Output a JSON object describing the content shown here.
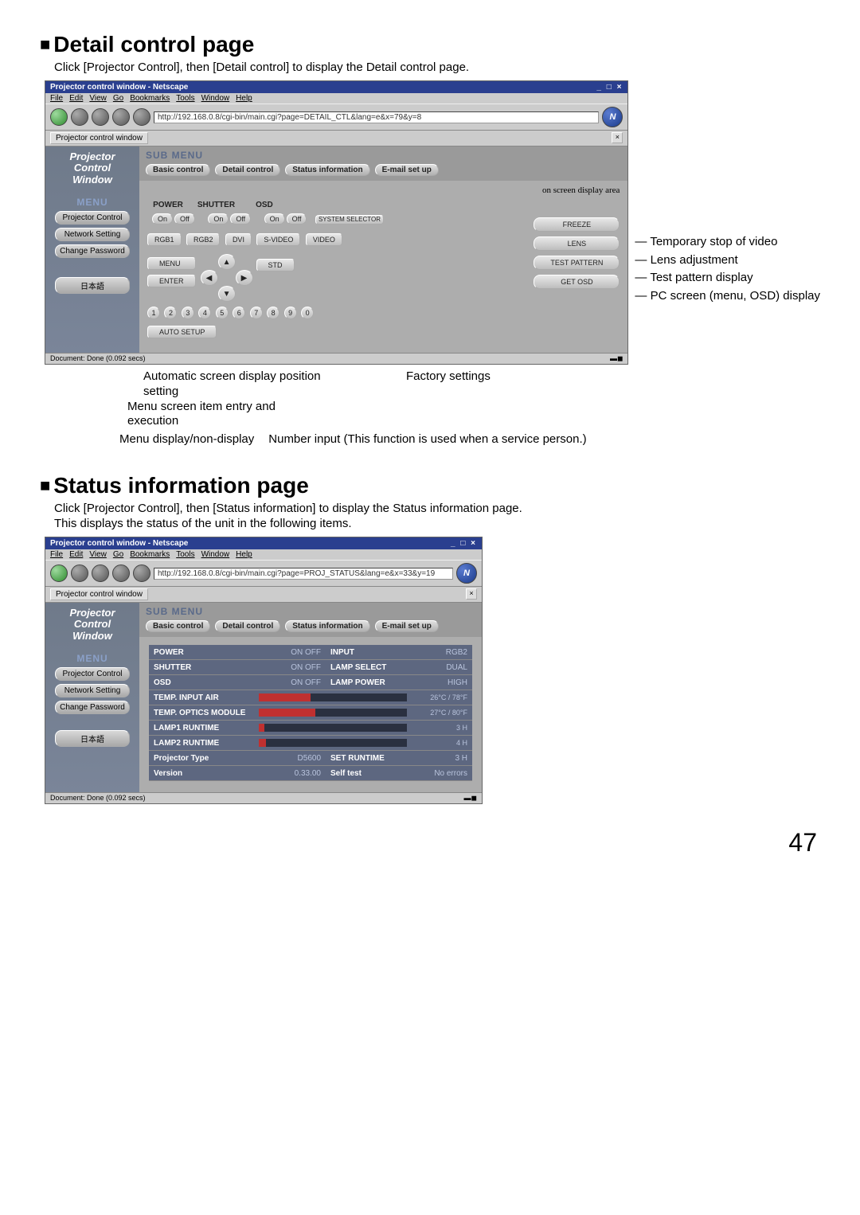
{
  "page_number": "47",
  "section1": {
    "title": "Detail control page",
    "intro": "Click [Projector Control], then [Detail control] to display the Detail control page."
  },
  "section2": {
    "title": "Status information page",
    "intro1": "Click [Projector Control], then [Status information] to display the Status information page.",
    "intro2": "This displays the status of the unit in the following items."
  },
  "browser": {
    "title": "Projector control window - Netscape",
    "winbtns": "_ □ ×",
    "menu": [
      "File",
      "Edit",
      "View",
      "Go",
      "Bookmarks",
      "Tools",
      "Window",
      "Help"
    ],
    "url1": "http://192.168.0.8/cgi-bin/main.cgi?page=DETAIL_CTL&lang=e&x=79&y=8",
    "url2": "http://192.168.0.8/cgi-bin/main.cgi?page=PROJ_STATUS&lang=e&x=33&y=19",
    "tab": "Projector control window",
    "status": "Document: Done (0.092 secs)"
  },
  "sidebar": {
    "title_l1": "Projector",
    "title_l2": "Control",
    "title_l3": "Window",
    "menu_lbl": "MENU",
    "buttons": [
      "Projector Control",
      "Network Setting",
      "Change Password",
      "日本語"
    ]
  },
  "subtabs": {
    "header": "SUB MENU",
    "items": [
      "Basic control",
      "Detail control",
      "Status information",
      "E-mail set up"
    ]
  },
  "detail": {
    "osda": "on screen display area",
    "labels": {
      "power": "POWER",
      "shutter": "SHUTTER",
      "osd": "OSD"
    },
    "on": "On",
    "off": "Off",
    "system_selector": "SYSTEM SELECTOR",
    "inputs": [
      "RGB1",
      "RGB2",
      "DVI",
      "S-VIDEO",
      "VIDEO"
    ],
    "menu": "MENU",
    "std": "STD",
    "enter": "ENTER",
    "nums": [
      "1",
      "2",
      "3",
      "4",
      "5",
      "6",
      "7",
      "8",
      "9",
      "0"
    ],
    "auto_setup": "AUTO SETUP",
    "right_btns": [
      "FREEZE",
      "LENS",
      "TEST PATTERN",
      "GET OSD"
    ]
  },
  "callouts": {
    "r1": "Temporary stop of video",
    "r2": "Lens adjustment",
    "r3": "Test pattern display",
    "r4": "PC screen (menu, OSD) display",
    "b_auto": "Automatic screen display position setting",
    "b_factory": "Factory settings",
    "b_menu_item": "Menu screen item entry and execution",
    "b_menu_disp": "Menu display/non-display",
    "b_num": "Number input (This function is used when a service person.)"
  },
  "status": {
    "rows_pair": [
      {
        "l": "POWER",
        "lv": "ON  OFF",
        "r": "INPUT",
        "rv": "RGB2"
      },
      {
        "l": "SHUTTER",
        "lv": "ON  OFF",
        "r": "LAMP SELECT",
        "rv": "DUAL"
      },
      {
        "l": "OSD",
        "lv": "ON  OFF",
        "r": "LAMP POWER",
        "rv": "HIGH"
      }
    ],
    "bars": [
      {
        "l": "TEMP. INPUT AIR",
        "pct": 35,
        "v": "26°C / 78°F"
      },
      {
        "l": "TEMP. OPTICS MODULE",
        "pct": 38,
        "v": "27°C / 80°F"
      },
      {
        "l": "LAMP1 RUNTIME",
        "pct": 4,
        "v": "3 H"
      },
      {
        "l": "LAMP2 RUNTIME",
        "pct": 5,
        "v": "4 H"
      }
    ],
    "rows_pair2": [
      {
        "l": "Projector Type",
        "lv": "D5600",
        "r": "SET RUNTIME",
        "rv": "3 H"
      },
      {
        "l": "Version",
        "lv": "0.33.00",
        "r": "Self test",
        "rv": "No errors"
      }
    ]
  }
}
